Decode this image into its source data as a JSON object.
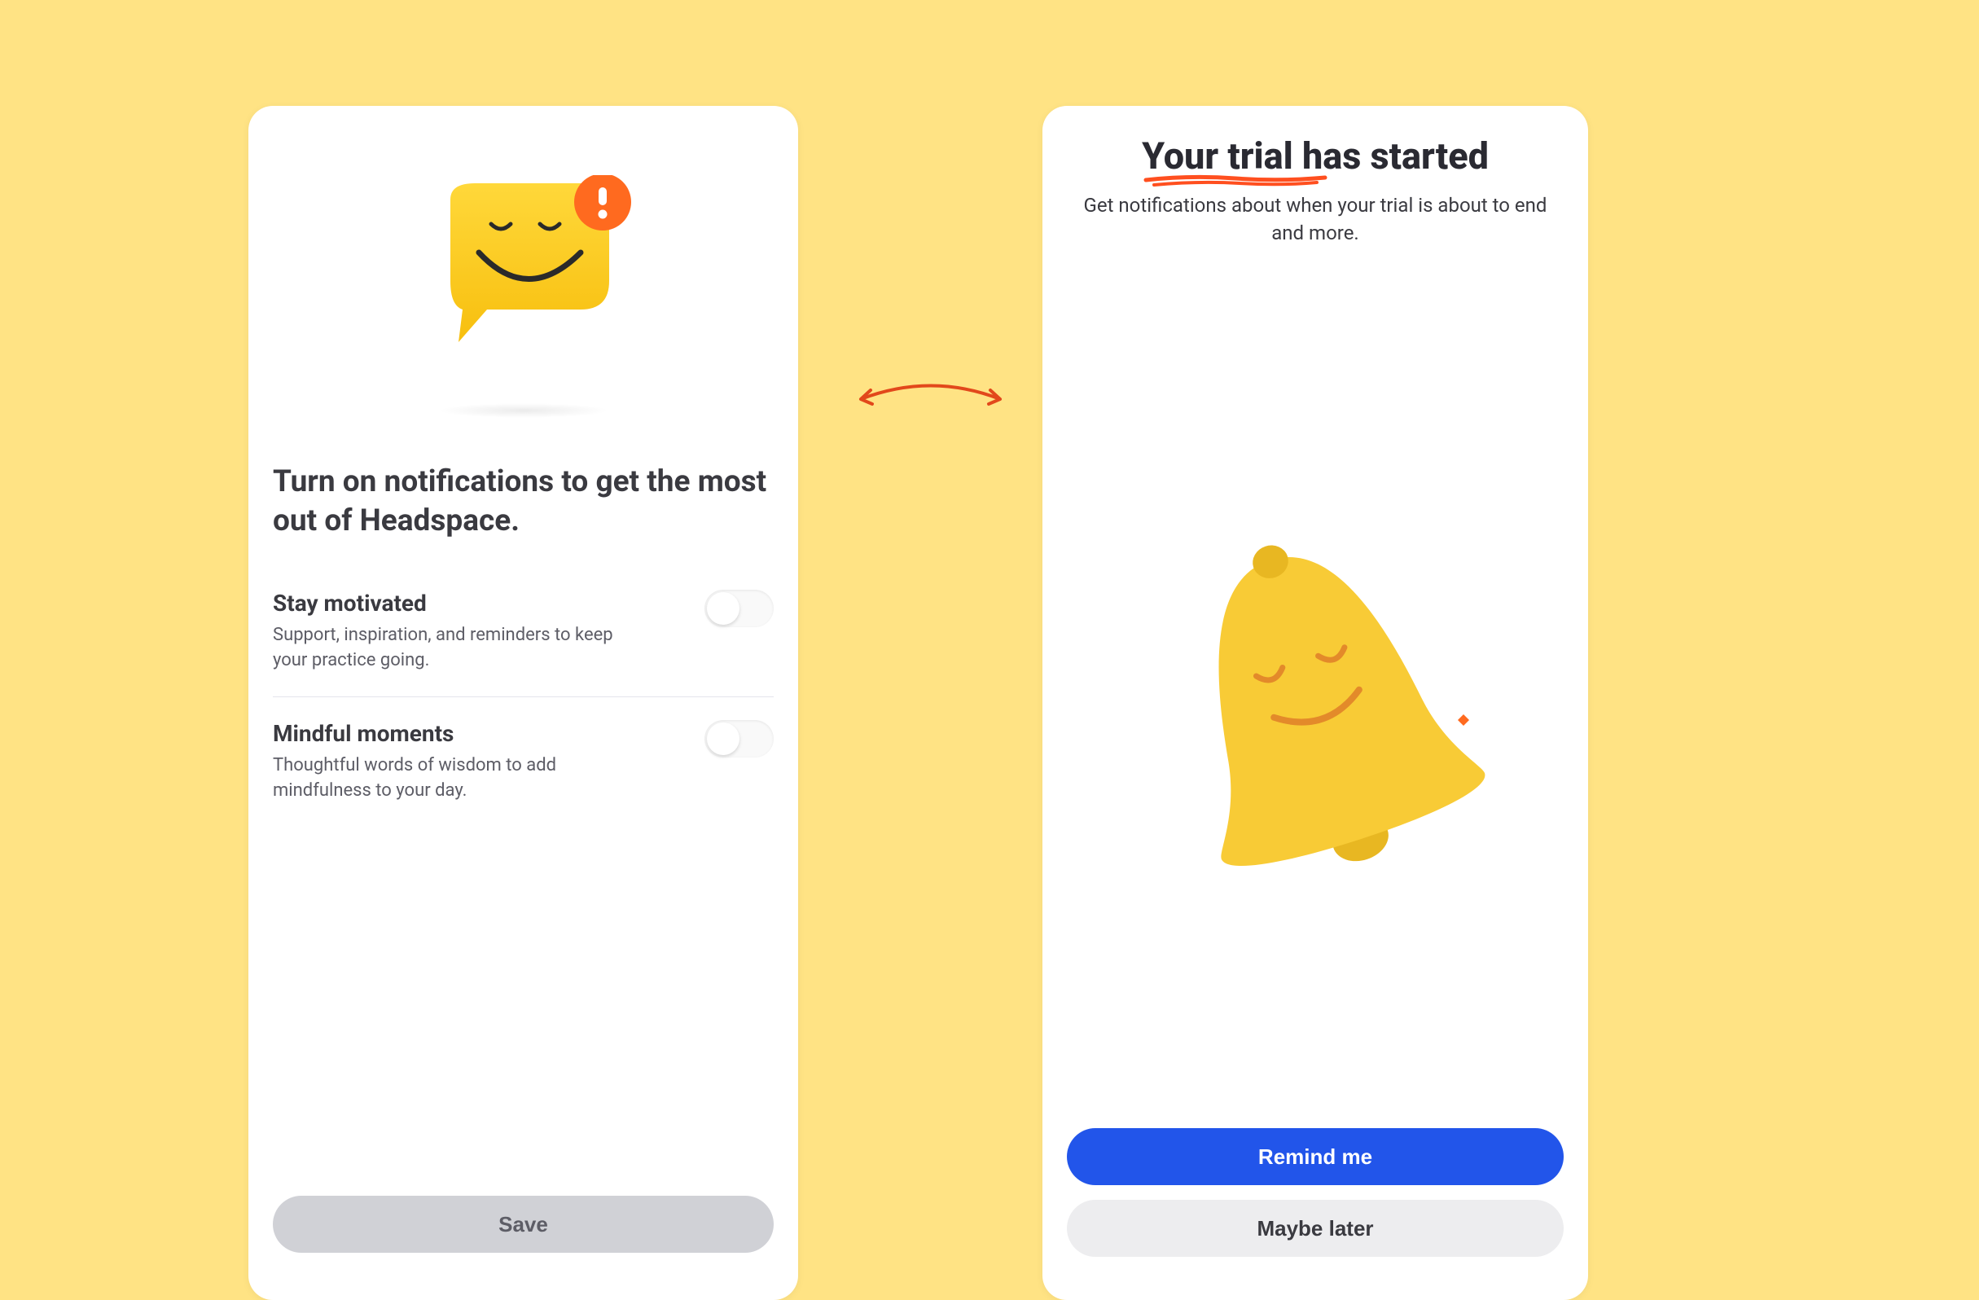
{
  "left": {
    "heading": "Turn on notifications to get the most out of Headspace.",
    "toggles": [
      {
        "title": "Stay motivated",
        "desc": "Support, inspiration, and reminders to keep your practice going.",
        "on": false
      },
      {
        "title": "Mindful moments",
        "desc": "Thoughtful words of wisdom to add mindfulness to your day.",
        "on": false
      }
    ],
    "save_label": "Save"
  },
  "right": {
    "heading": "Your trial has started",
    "subtext": "Get notifications about when your trial is about to end and more.",
    "primary_label": "Remind me",
    "secondary_label": "Maybe later"
  },
  "colors": {
    "background": "#ffe384",
    "accent_orange": "#ff4f1f",
    "primary_blue": "#2255ea",
    "bubble_yellow": "#fdcd1e",
    "bell_yellow": "#f8cb36"
  }
}
